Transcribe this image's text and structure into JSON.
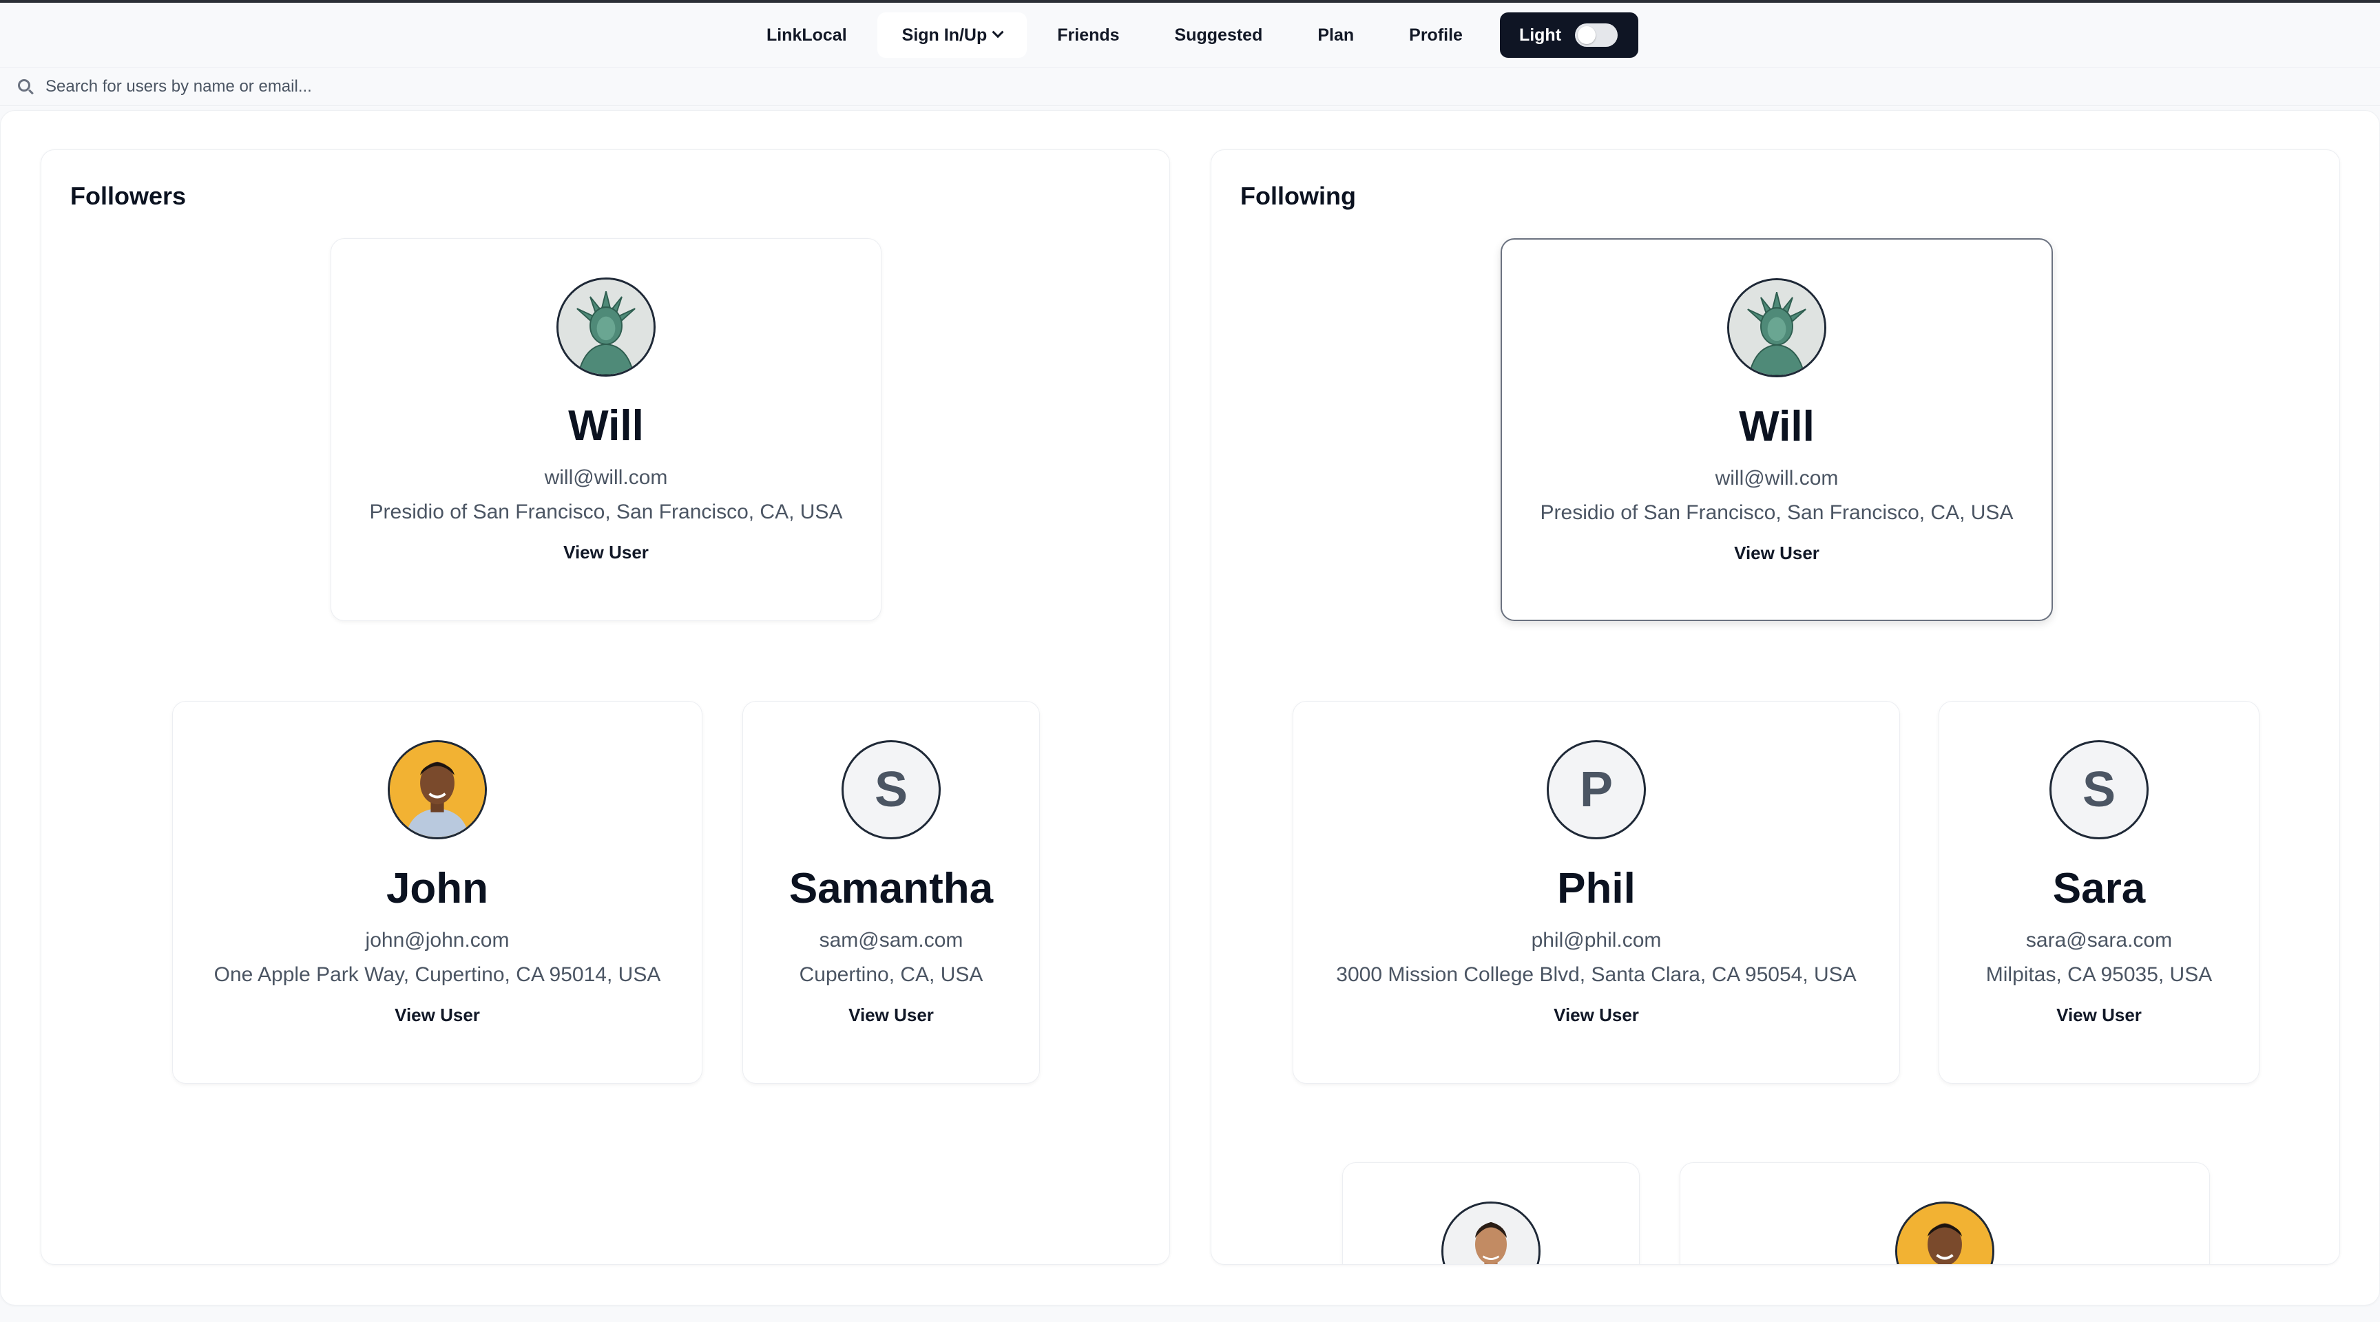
{
  "nav": {
    "brand": "LinkLocal",
    "sign_in": "Sign In/Up",
    "friends": "Friends",
    "suggested": "Suggested",
    "plan": "Plan",
    "profile": "Profile",
    "theme_label": "Light"
  },
  "search": {
    "placeholder": "Search for users by name or email..."
  },
  "followers": {
    "title": "Followers",
    "users": [
      {
        "name": "Will",
        "email": "will@will.com",
        "address": "Presidio of San Francisco, San Francisco, CA, USA",
        "action": "View User",
        "avatar": "statue-photo"
      },
      {
        "name": "John",
        "email": "john@john.com",
        "address": "One Apple Park Way, Cupertino, CA 95014, USA",
        "action": "View User",
        "avatar": "person-photo"
      },
      {
        "name": "Samantha",
        "initial": "S",
        "email": "sam@sam.com",
        "address": "Cupertino, CA, USA",
        "action": "View User"
      }
    ]
  },
  "following": {
    "title": "Following",
    "users": [
      {
        "name": "Will",
        "email": "will@will.com",
        "address": "Presidio of San Francisco, San Francisco, CA, USA",
        "action": "View User",
        "avatar": "statue-photo"
      },
      {
        "name": "Phil",
        "initial": "P",
        "email": "phil@phil.com",
        "address": "3000 Mission College Blvd, Santa Clara, CA 95054, USA",
        "action": "View User"
      },
      {
        "name": "Sara",
        "initial": "S",
        "email": "sara@sara.com",
        "address": "Milpitas, CA 95035, USA",
        "action": "View User"
      },
      {
        "avatar": "person-photo"
      },
      {
        "avatar": "person-photo"
      }
    ]
  },
  "colors": {
    "nav_dark": "#0f1524",
    "text": "#0b1220",
    "muted": "#4b5563",
    "avatar_yellow": "#f2b233"
  }
}
